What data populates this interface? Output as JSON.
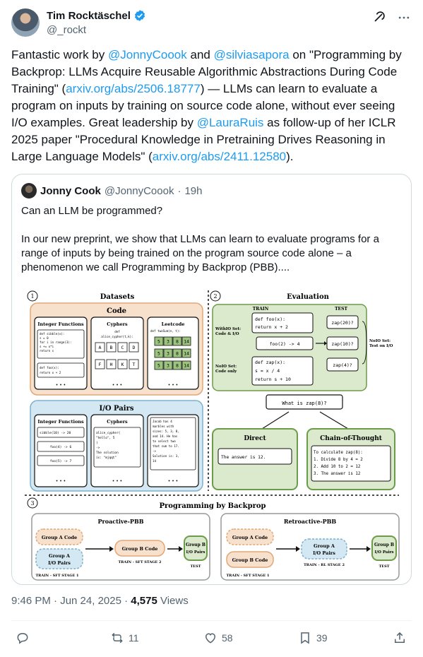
{
  "author": {
    "name": "Tim Rocktäschel",
    "handle": "@_rockt"
  },
  "tweet": {
    "t1": "Fantastic work by ",
    "m1": "@JonnyCoook",
    "t2": " and ",
    "m2": "@silviasapora",
    "t3": " on \"Programming by Backprop: LLMs Acquire Reusable Algorithmic Abstractions During Code Training\" (",
    "l1": "arxiv.org/abs/2506.18777",
    "t4": ") — LLMs can learn to evaluate a program on inputs by training on source code alone, without ever seeing I/O examples. Great leadership by ",
    "m3": "@LauraRuis",
    "t5": " as follow-up of her ICLR 2025 paper \"Procedural Knowledge in Pretraining Drives Reasoning in Large Language Models\" (",
    "l2": "arxiv.org/abs/2411.12580",
    "t6": ")."
  },
  "quote": {
    "name": "Jonny Cook",
    "handle": "@JonnyCoook",
    "dot": "·",
    "time": "19h",
    "p1": "Can an LLM be programmed?",
    "p2": "In our new preprint, we show that LLMs can learn to evaluate programs for a range of inputs by being trained on the program source code alone – a phenomenon we call Programming by Backprop (PBB)...."
  },
  "figure": {
    "s1": "1",
    "s2": "2",
    "s3": "3",
    "datasets": "Datasets",
    "evaluation": "Evaluation",
    "code": "Code",
    "io_pairs": "I/O Pairs",
    "integer_functions": "Integer Functions",
    "cyphers": "Cyphers",
    "leetcode": "Leetcode",
    "c1_l1": "def sibble(x):",
    "c1_l2": "  s = 0",
    "c1_l3": "  for i in range(3):",
    "c1_l4": "    s += x*i",
    "c1_l5": "  return s",
    "c1_foo1": "def foo(x):",
    "c1_foo2": "  return x + 2",
    "cy_def": "def",
    "cy_sig": "alice_cypher(t,k):",
    "cy_row1": [
      "A",
      "B",
      "C",
      "D"
    ],
    "cy_row2": [
      "F",
      "H",
      "K",
      "T"
    ],
    "lc_def": "def twoSum(n, t):",
    "lc_row": [
      "5",
      "3",
      "8",
      "14"
    ],
    "dots": "• • •",
    "io1": "sibble(10) -> 20",
    "io2": "foo(4) -> 6",
    "io3": "foo(5) -> 7",
    "io_cy1": "alice_cypher(",
    "io_cy2": "  \"hello\", 5",
    "io_cy3": ")",
    "io_cy4": "->",
    "io_cy5": "The solution",
    "io_cy6": "is: \"mjqqt\"",
    "io_lc1": "Jacob has 4",
    "io_lc2": "marbles with",
    "io_lc3": "sizes: 5, 3, 8,",
    "io_lc4": "and 14. He has",
    "io_lc5": "to select two",
    "io_lc6": "that sum to 17.",
    "io_lc7": "->",
    "io_lc8": "Solution is: 3,",
    "io_lc9": "14",
    "train": "TRAIN",
    "test": "TEST",
    "withio1": "WithIO Set:",
    "withio2": "Code & I/O",
    "noio1": "NoIO Set:",
    "noio2": "Code only",
    "foo_def": "def foo(x):",
    "foo_ret": "  return x + 2",
    "foo_call": "foo(2) -> 4",
    "zap_def": "def zap(x):",
    "zap_l2": "  s = x / 4",
    "zap_l3": "  return s + 10",
    "zap20": "zap(20)?",
    "zap10": "zap(10)?",
    "zap4": "zap(4)?",
    "noio_test1": "NoIO Set:",
    "noio_test2": "Test on I/O",
    "question": "What is zap(8)?",
    "direct": "Direct",
    "direct_ans": "The answer is 12.",
    "cot": "Chain-of-Thought",
    "cot1": "To calculate zap(8):",
    "cot2": "1. Divide 8 by 4 = 2",
    "cot3": "2. Add 10 to 2 = 12",
    "cot4": "3. The answer is 12",
    "pbb": "Programming by Backprop",
    "proactive": "Proactive-PBB",
    "retroactive": "Retroactive-PBB",
    "group_a_code": "Group A Code",
    "group_a_io1": "Group A",
    "group_a_io2": "I/O Pairs",
    "group_b_code": "Group B Code",
    "group_b_io1": "Group B",
    "group_b_io2": "I/O Pairs",
    "sft1": "TRAIN - SFT STAGE 1",
    "sft2": "TRAIN - SFT STAGE 2",
    "rl2": "TRAIN - RL STAGE 2",
    "test_lbl": "TEST"
  },
  "meta": {
    "time": "9:46 PM · Jun 24, 2025 · ",
    "views_count": "4,575",
    "views_label": " Views"
  },
  "actions": {
    "retweets": "11",
    "likes": "58",
    "bookmarks": "39"
  },
  "colors": {
    "link": "#1d9bf0",
    "code_panel": "#f7e0cc",
    "io_panel": "#d3e8f2",
    "eval_panel": "#dbe9cc"
  }
}
